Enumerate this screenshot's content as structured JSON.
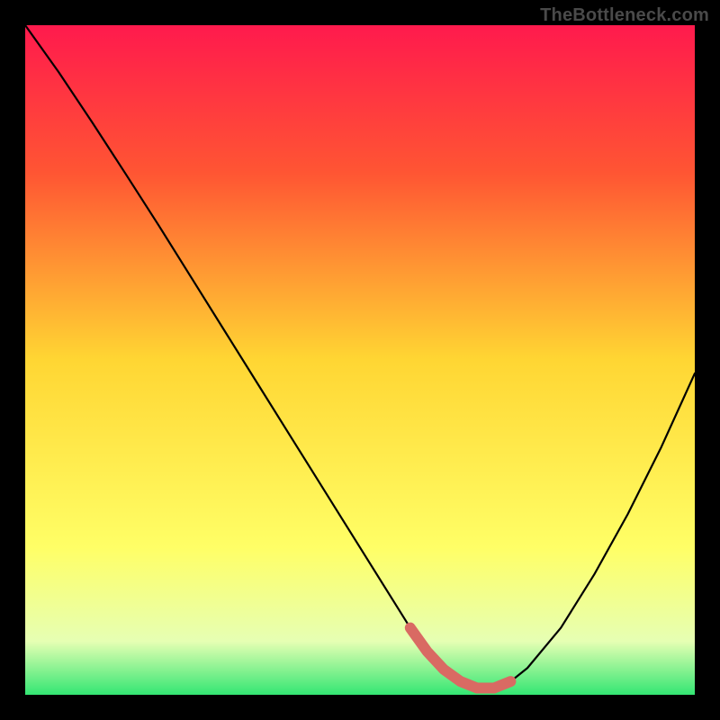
{
  "watermark": "TheBottleneck.com",
  "colors": {
    "background": "#000000",
    "watermarkText": "#4a4a4a",
    "curveStroke": "#000000",
    "markerFill": "#d96a63",
    "gradientTop": "#ff1a4d",
    "gradientUpper": "#ff5533",
    "gradientMid": "#ffd633",
    "gradientLower": "#ffff66",
    "gradientPale": "#e6ffb3",
    "gradientBottom": "#33e673"
  },
  "chart_data": {
    "type": "line",
    "title": "",
    "xlabel": "",
    "ylabel": "",
    "xlim": [
      0,
      100
    ],
    "ylim": [
      0,
      100
    ],
    "grid": false,
    "legend": false,
    "series": [
      {
        "name": "bottleneck-curve",
        "x": [
          0,
          5,
          10,
          15,
          20,
          25,
          30,
          35,
          40,
          45,
          50,
          55,
          57.5,
          60,
          62.5,
          65,
          67.5,
          70,
          72.5,
          75,
          80,
          85,
          90,
          95,
          100
        ],
        "values": [
          100,
          93,
          85.5,
          77.8,
          70,
          62,
          54,
          46,
          38,
          30,
          22,
          14,
          10,
          6.5,
          3.8,
          2,
          1,
          1,
          2,
          4,
          10,
          18,
          27,
          37,
          48
        ]
      }
    ],
    "markers": {
      "name": "optimal-range",
      "x": [
        57.5,
        60,
        62.5,
        65,
        67.5,
        70,
        72.5
      ],
      "values": [
        10,
        6.5,
        3.8,
        2,
        1,
        1,
        2
      ]
    }
  }
}
